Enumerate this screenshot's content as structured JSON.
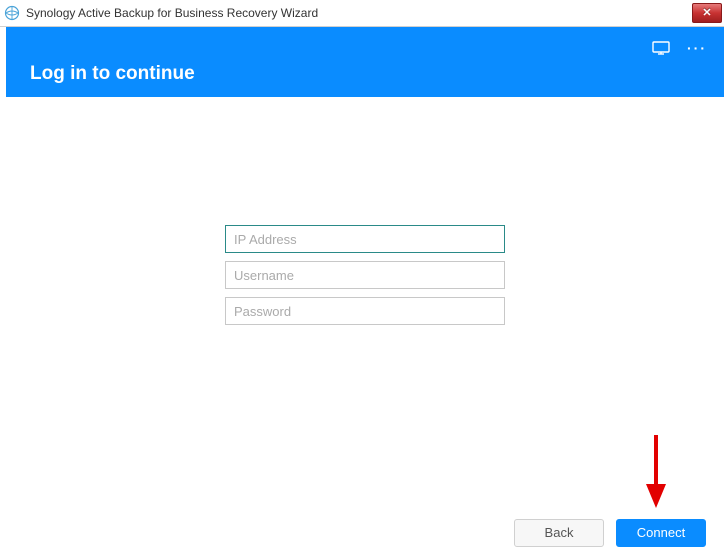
{
  "titlebar": {
    "title": "Synology Active Backup for Business Recovery Wizard"
  },
  "header": {
    "title": "Log in to continue"
  },
  "form": {
    "ip": {
      "placeholder": "IP Address",
      "value": ""
    },
    "username": {
      "placeholder": "Username",
      "value": ""
    },
    "password": {
      "placeholder": "Password",
      "value": ""
    }
  },
  "footer": {
    "back": "Back",
    "connect": "Connect"
  },
  "colors": {
    "accent": "#0a8cff",
    "close": "#c83232"
  }
}
